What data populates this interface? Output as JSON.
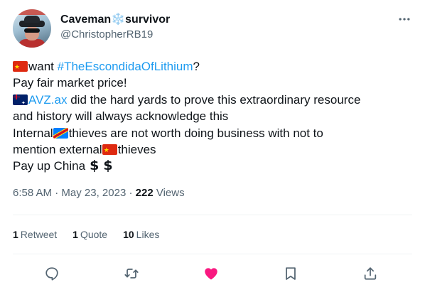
{
  "author": {
    "name_first": "Caveman",
    "name_emoji": "❄️",
    "name_last": "survivor",
    "handle": "@ChristopherRB19"
  },
  "tweet": {
    "line1_text": "want ",
    "line1_hashtag": "#TheEscondidaOfLithium",
    "line1_end": "?",
    "line2": "Pay fair market price!",
    "line3_link": "AVZ.ax",
    "line3_text": " did the hard yards to prove this extraordinary resource",
    "line4": "and history will always acknowledge this",
    "line5_a": "Internal",
    "line5_b": "thieves are not worth doing business with not to",
    "line6_a": "mention external",
    "line6_b": "thieves",
    "line7": "Pay up China",
    "dollar_1": "$",
    "dollar_2": "$"
  },
  "meta": {
    "time": "6:58 AM",
    "sep1": " · ",
    "date": "May 23, 2023",
    "sep2": " · ",
    "views_count": "222",
    "views_label": " Views"
  },
  "stats": {
    "retweets_count": "1",
    "retweets_label": "Retweet",
    "quotes_count": "1",
    "quotes_label": "Quote",
    "likes_count": "10",
    "likes_label": "Likes"
  },
  "icons": {
    "reply": "reply-icon",
    "retweet": "retweet-icon",
    "like": "heart-icon",
    "bookmark": "bookmark-icon",
    "share": "share-icon",
    "more": "more-icon"
  },
  "colors": {
    "link": "#1d9bf0",
    "text": "#0f1419",
    "secondary": "#536471",
    "liked": "#f91880",
    "divider": "#eff3f4"
  }
}
